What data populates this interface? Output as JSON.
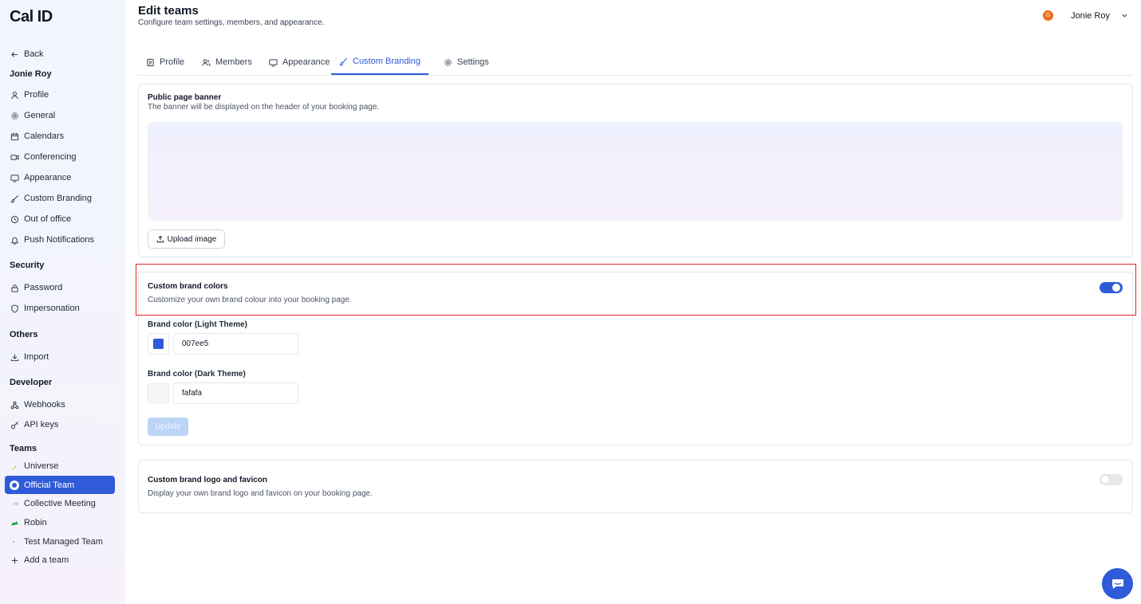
{
  "app": {
    "logo": "Cal ID"
  },
  "sidebar": {
    "back_label": "Back",
    "user_heading": "Jonie Roy",
    "user_items": [
      {
        "label": "Profile",
        "icon": "user-icon"
      },
      {
        "label": "General",
        "icon": "gear-icon"
      },
      {
        "label": "Calendars",
        "icon": "calendar-icon"
      },
      {
        "label": "Conferencing",
        "icon": "video-icon"
      },
      {
        "label": "Appearance",
        "icon": "monitor-icon"
      },
      {
        "label": "Custom Branding",
        "icon": "brush-icon"
      },
      {
        "label": "Out of office",
        "icon": "clock-icon"
      },
      {
        "label": "Push Notifications",
        "icon": "bell-icon"
      }
    ],
    "security_heading": "Security",
    "security_items": [
      {
        "label": "Password",
        "icon": "lock-icon"
      },
      {
        "label": "Impersonation",
        "icon": "shield-icon"
      }
    ],
    "others_heading": "Others",
    "others_items": [
      {
        "label": "Import",
        "icon": "download-icon"
      }
    ],
    "developer_heading": "Developer",
    "developer_items": [
      {
        "label": "Webhooks",
        "icon": "webhook-icon"
      },
      {
        "label": "API keys",
        "icon": "key-icon"
      }
    ],
    "teams_heading": "Teams",
    "team_items": [
      {
        "label": "Universe",
        "icon": "universe-team-logo-icon"
      },
      {
        "label": "Official Team",
        "icon": "official-team-logo-icon",
        "active": true
      },
      {
        "label": "Collective Meeting",
        "icon": "collective-team-logo-icon"
      },
      {
        "label": "Robin",
        "icon": "robin-team-logo-icon"
      },
      {
        "label": "Test Managed Team",
        "icon": "managed-team-logo-icon"
      }
    ],
    "add_team_label": "Add a team"
  },
  "header": {
    "title": "Edit teams",
    "subtitle": "Configure team settings, members, and appearance.",
    "user_initial": "G",
    "user_name": "Jonie Roy"
  },
  "tabs": [
    {
      "label": "Profile",
      "icon": "profile-doc-icon"
    },
    {
      "label": "Members",
      "icon": "users-icon"
    },
    {
      "label": "Appearance",
      "icon": "monitor-icon"
    },
    {
      "label": "Custom Branding",
      "icon": "brush-icon",
      "active": true
    },
    {
      "label": "Settings",
      "icon": "gear-icon"
    }
  ],
  "banner_card": {
    "title": "Public page banner",
    "description": "The banner will be displayed on the header of your booking page.",
    "upload_label": "Upload image"
  },
  "brand_colors": {
    "title": "Custom brand colors",
    "description": "Customize your own brand colour into your booking page.",
    "enabled": true,
    "light_label": "Brand color (Light Theme)",
    "light_value": "007ee5",
    "light_swatch": "#2f5bd8",
    "dark_label": "Brand color (Dark Theme)",
    "dark_value": "fafafa",
    "dark_swatch": "#f5f5f5",
    "update_label": "Update"
  },
  "logo_card": {
    "title": "Custom brand logo and favicon",
    "description": "Display your own brand logo and favicon on your booking page.",
    "enabled": false
  },
  "colors": {
    "accent": "#2f5bd8",
    "highlight": "#dc2626",
    "avatar": "#f26b1d"
  }
}
